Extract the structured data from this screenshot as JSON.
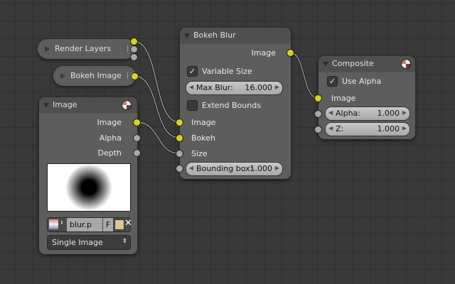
{
  "nodes": {
    "render_layers": {
      "title": "Render Layers"
    },
    "bokeh_image": {
      "title": "Bokeh Image"
    },
    "image": {
      "title": "Image",
      "outputs": [
        "Image",
        "Alpha",
        "Depth"
      ],
      "file_name": "blur.p",
      "fake_user": "F",
      "source": "Single Image"
    },
    "bokeh_blur": {
      "title": "Bokeh Blur",
      "output": "Image",
      "variable_size": "Variable Size",
      "variable_size_checked": true,
      "max_blur_label": "Max Blur:",
      "max_blur": "16.000",
      "extend_bounds": "Extend Bounds",
      "extend_bounds_checked": false,
      "inputs": [
        "Image",
        "Bokeh",
        "Size"
      ],
      "bbox_label": "Bounding box:",
      "bbox": "1.000"
    },
    "composite": {
      "title": "Composite",
      "use_alpha": "Use Alpha",
      "use_alpha_checked": true,
      "input_image": "Image",
      "alpha_label": "Alpha:",
      "alpha": "1.000",
      "z_label": "Z:",
      "z": "1.000"
    }
  },
  "colors": {
    "socket_color": "#d8d21e",
    "socket_value": "#a8a8a8",
    "background": "#393939"
  }
}
